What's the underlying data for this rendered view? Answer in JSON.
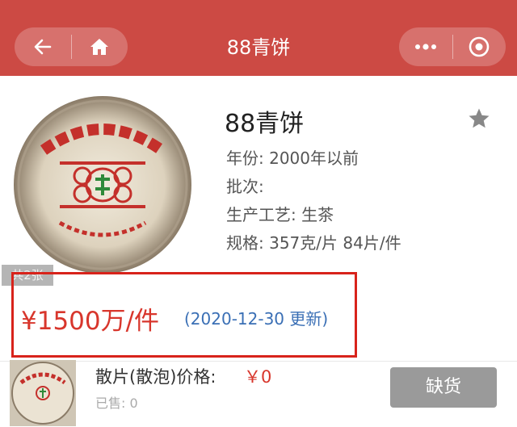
{
  "header": {
    "title": "88青饼",
    "back_icon": "arrow-left-icon",
    "home_icon": "home-icon",
    "more_icon": "more-dots-icon",
    "capsule_icon": "target-circle-icon",
    "background_color": "#cc4a44"
  },
  "product": {
    "name": "88青饼",
    "image_badge": "共2张",
    "favorite_icon": "star-icon",
    "attributes": [
      {
        "label": "年份:",
        "value": "2000年以前"
      },
      {
        "label": "批次:",
        "value": ""
      },
      {
        "label": "生产工艺:",
        "value": "生茶"
      },
      {
        "label": "规格:",
        "value": "357克/片 84片/件"
      }
    ]
  },
  "price": {
    "amount": "¥1500万/件",
    "update_note": "(2020-12-30 更新)",
    "color": "#d8362c"
  },
  "spec_item": {
    "label": "散片(散泡)价格:",
    "price": "￥0",
    "sold": "已售: 0",
    "button_label": "缺货"
  }
}
